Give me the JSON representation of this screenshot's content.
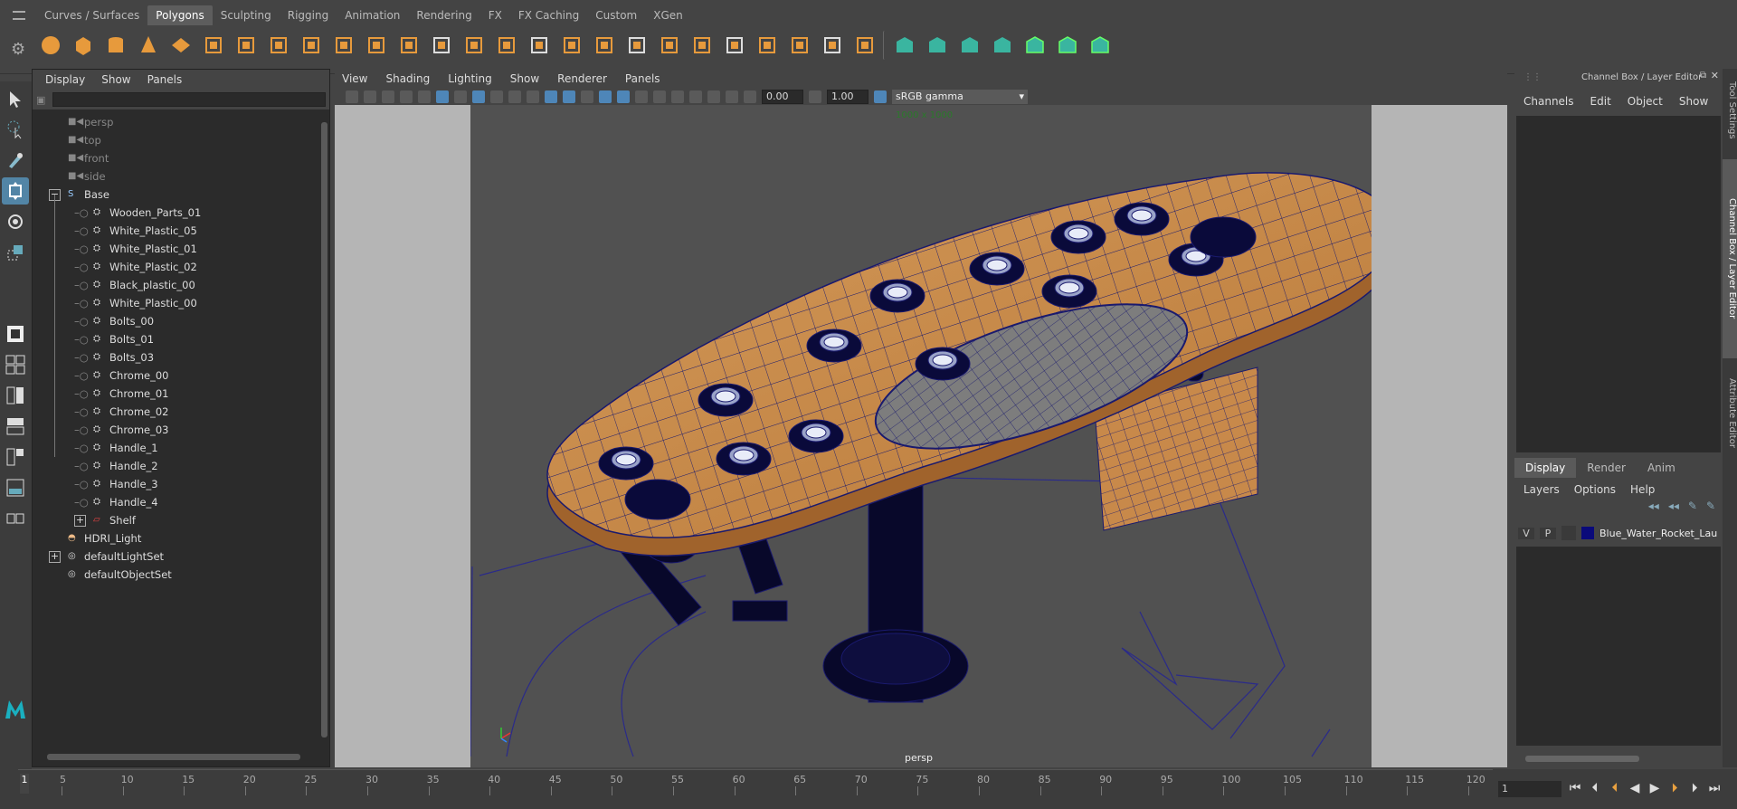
{
  "shelf_tabs": [
    "Curves / Surfaces",
    "Polygons",
    "Sculpting",
    "Rigging",
    "Animation",
    "Rendering",
    "FX",
    "FX Caching",
    "Custom",
    "XGen"
  ],
  "shelf_tab_active": "Polygons",
  "shelf_icons": [
    "sphere-icon",
    "cube-icon",
    "cylinder-icon",
    "cone-icon",
    "plane-icon",
    "torus-icon",
    "prism-icon",
    "pipe-icon",
    "combine-icon",
    "separate-icon",
    "smooth-icon",
    "grid-icon",
    "platonic-icon",
    "bevel-icon",
    "multicut-icon",
    "extrude-icon",
    "bridge-icon",
    "fill-hole-icon",
    "quad-draw-icon",
    "crease-icon",
    "mirror-icon",
    "uv-planar-icon",
    "uv-editor-icon",
    "snap-icon",
    "soft-select-icon",
    "sculpt-icon",
    "separator",
    "green-cube-1",
    "green-cube-2",
    "green-cube-3",
    "green-cube-4",
    "green-swap",
    "green-check",
    "green-x"
  ],
  "outliner": {
    "menu": [
      "Display",
      "Show",
      "Panels"
    ],
    "rows": [
      {
        "label": "persp",
        "kind": "camera",
        "dim": true,
        "depth": 1
      },
      {
        "label": "top",
        "kind": "camera",
        "dim": true,
        "depth": 1
      },
      {
        "label": "front",
        "kind": "camera",
        "dim": true,
        "depth": 1
      },
      {
        "label": "side",
        "kind": "camera",
        "dim": true,
        "depth": 1
      },
      {
        "label": "Base",
        "kind": "curve",
        "expander": "-",
        "depth": 1
      },
      {
        "label": "Wooden_Parts_01",
        "kind": "mesh",
        "depth": 2
      },
      {
        "label": "White_Plastic_05",
        "kind": "mesh",
        "depth": 2
      },
      {
        "label": "White_Plastic_01",
        "kind": "mesh",
        "depth": 2
      },
      {
        "label": "White_Plastic_02",
        "kind": "mesh",
        "depth": 2
      },
      {
        "label": "Black_plastic_00",
        "kind": "mesh",
        "depth": 2
      },
      {
        "label": "White_Plastic_00",
        "kind": "mesh",
        "depth": 2
      },
      {
        "label": "Bolts_00",
        "kind": "mesh",
        "depth": 2
      },
      {
        "label": "Bolts_01",
        "kind": "mesh",
        "depth": 2
      },
      {
        "label": "Bolts_03",
        "kind": "mesh",
        "depth": 2
      },
      {
        "label": "Chrome_00",
        "kind": "mesh",
        "depth": 2
      },
      {
        "label": "Chrome_01",
        "kind": "mesh",
        "depth": 2
      },
      {
        "label": "Chrome_02",
        "kind": "mesh",
        "depth": 2
      },
      {
        "label": "Chrome_03",
        "kind": "mesh",
        "depth": 2
      },
      {
        "label": "Handle_1",
        "kind": "mesh",
        "depth": 2
      },
      {
        "label": "Handle_2",
        "kind": "mesh",
        "depth": 2
      },
      {
        "label": "Handle_3",
        "kind": "mesh",
        "depth": 2
      },
      {
        "label": "Handle_4",
        "kind": "mesh",
        "depth": 2
      },
      {
        "label": "Shelf",
        "kind": "group",
        "expander": "+",
        "depth": 2
      },
      {
        "label": "HDRI_Light",
        "kind": "light",
        "depth": 1
      },
      {
        "label": "defaultLightSet",
        "kind": "set",
        "expander": "+",
        "depth": 1
      },
      {
        "label": "defaultObjectSet",
        "kind": "set",
        "depth": 1
      }
    ]
  },
  "viewport": {
    "menu": [
      "View",
      "Shading",
      "Lighting",
      "Show",
      "Renderer",
      "Panels"
    ],
    "exposure": "0.00",
    "gamma": "1.00",
    "color_space": "sRGB gamma",
    "resolution_label": "1000 x 1000",
    "camera_label": "persp"
  },
  "channel_box": {
    "title": "Channel Box / Layer Editor",
    "menu": [
      "Channels",
      "Edit",
      "Object",
      "Show"
    ],
    "layer_tabs": [
      "Display",
      "Render",
      "Anim"
    ],
    "layer_tab_active": "Display",
    "layer_menu": [
      "Layers",
      "Options",
      "Help"
    ],
    "layer_row": {
      "v": "V",
      "p": "P",
      "name": "Blue_Water_Rocket_Laur",
      "color": "#0a0a7a"
    }
  },
  "side_tabs": [
    "Tool Settings",
    "Channel Box / Layer Editor",
    "Attribute Editor"
  ],
  "timeline": {
    "ticks": [
      "5",
      "10",
      "15",
      "20",
      "25",
      "30",
      "35",
      "40",
      "45",
      "50",
      "55",
      "60",
      "65",
      "70",
      "75",
      "80",
      "85",
      "90",
      "95",
      "100",
      "105",
      "110",
      "115",
      "120"
    ],
    "current_frame": "1",
    "frame_field": "1"
  },
  "colors": {
    "accent": "#5285a6",
    "wood": "#c8894a",
    "wire": "#1a1a6e"
  }
}
